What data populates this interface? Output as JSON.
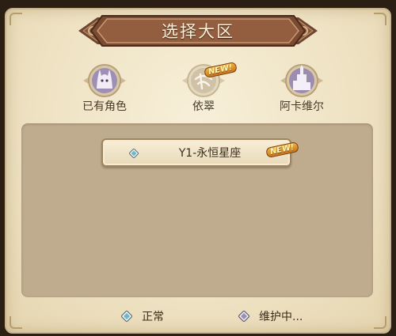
{
  "title": "选择大区",
  "tabs": [
    {
      "label": "已有角色",
      "icon": "character-emblem",
      "new": false
    },
    {
      "label": "依翠",
      "icon": "yicui-emblem",
      "new": true
    },
    {
      "label": "阿卡维尔",
      "icon": "akavir-emblem",
      "new": false
    }
  ],
  "new_badge_text": "NEW!",
  "servers": [
    {
      "name": "Y1-永恒星座",
      "status": "normal",
      "new": true
    }
  ],
  "legend": {
    "normal_label": "正常",
    "maintenance_label": "维护中..."
  },
  "colors": {
    "normal": "#6fb8c8",
    "maintenance": "#9a8fb0",
    "banner": "#8a5a3c"
  }
}
